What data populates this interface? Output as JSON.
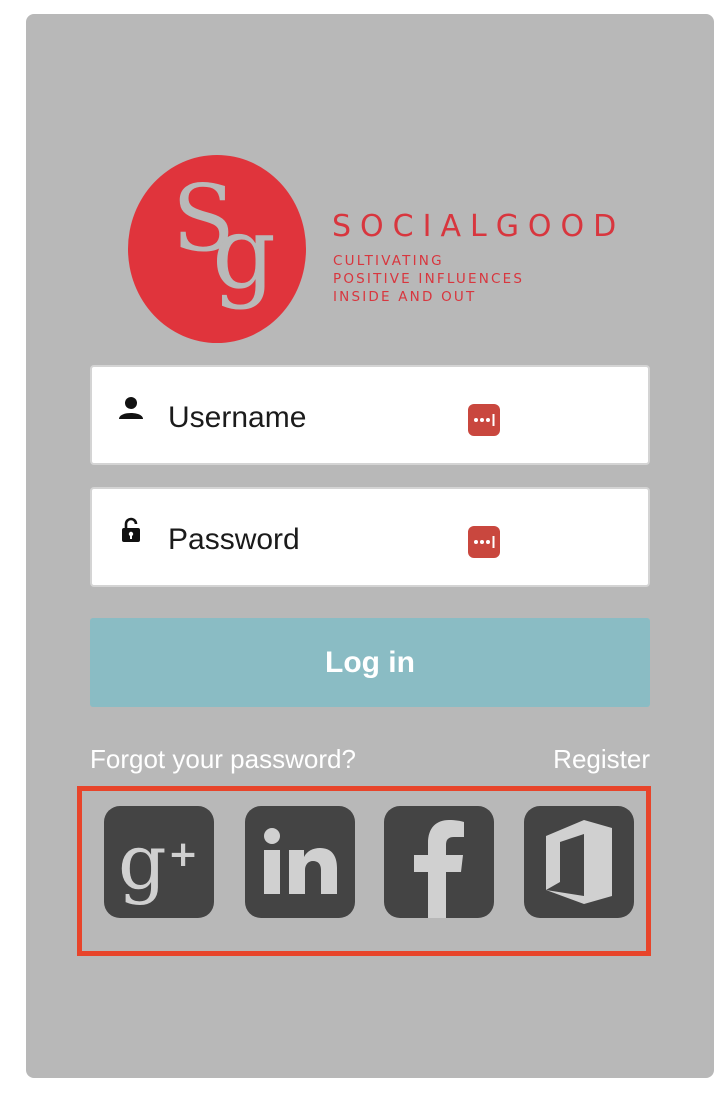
{
  "logo": {
    "monogram": "Sg",
    "brand_name": "SOCIALGOOD",
    "tagline": [
      "CULTIVATING",
      "POSITIVE INFLUENCES",
      "INSIDE AND OUT"
    ],
    "colors": {
      "circle": "#e0343c",
      "monogram": "#b9b9b9",
      "text": "#d8363e"
    }
  },
  "form": {
    "username": {
      "placeholder": "Username",
      "value": "",
      "icon": "person-icon"
    },
    "password": {
      "placeholder": "Password",
      "value": "",
      "icon": "padlock-icon"
    },
    "password_manager_icon": "password-manager-icon",
    "login_label": "Log in"
  },
  "links": {
    "forgot": "Forgot your password?",
    "register": "Register"
  },
  "social": {
    "highlight_color": "#e8442a",
    "providers": [
      {
        "name": "Google+",
        "icon": "google-plus-icon"
      },
      {
        "name": "LinkedIn",
        "icon": "linkedin-icon"
      },
      {
        "name": "Facebook",
        "icon": "facebook-icon"
      },
      {
        "name": "Office",
        "icon": "office-icon"
      }
    ]
  },
  "colors": {
    "panel": "#b8b8b8",
    "button": "#8abcc4",
    "social_tile": "#444444"
  }
}
